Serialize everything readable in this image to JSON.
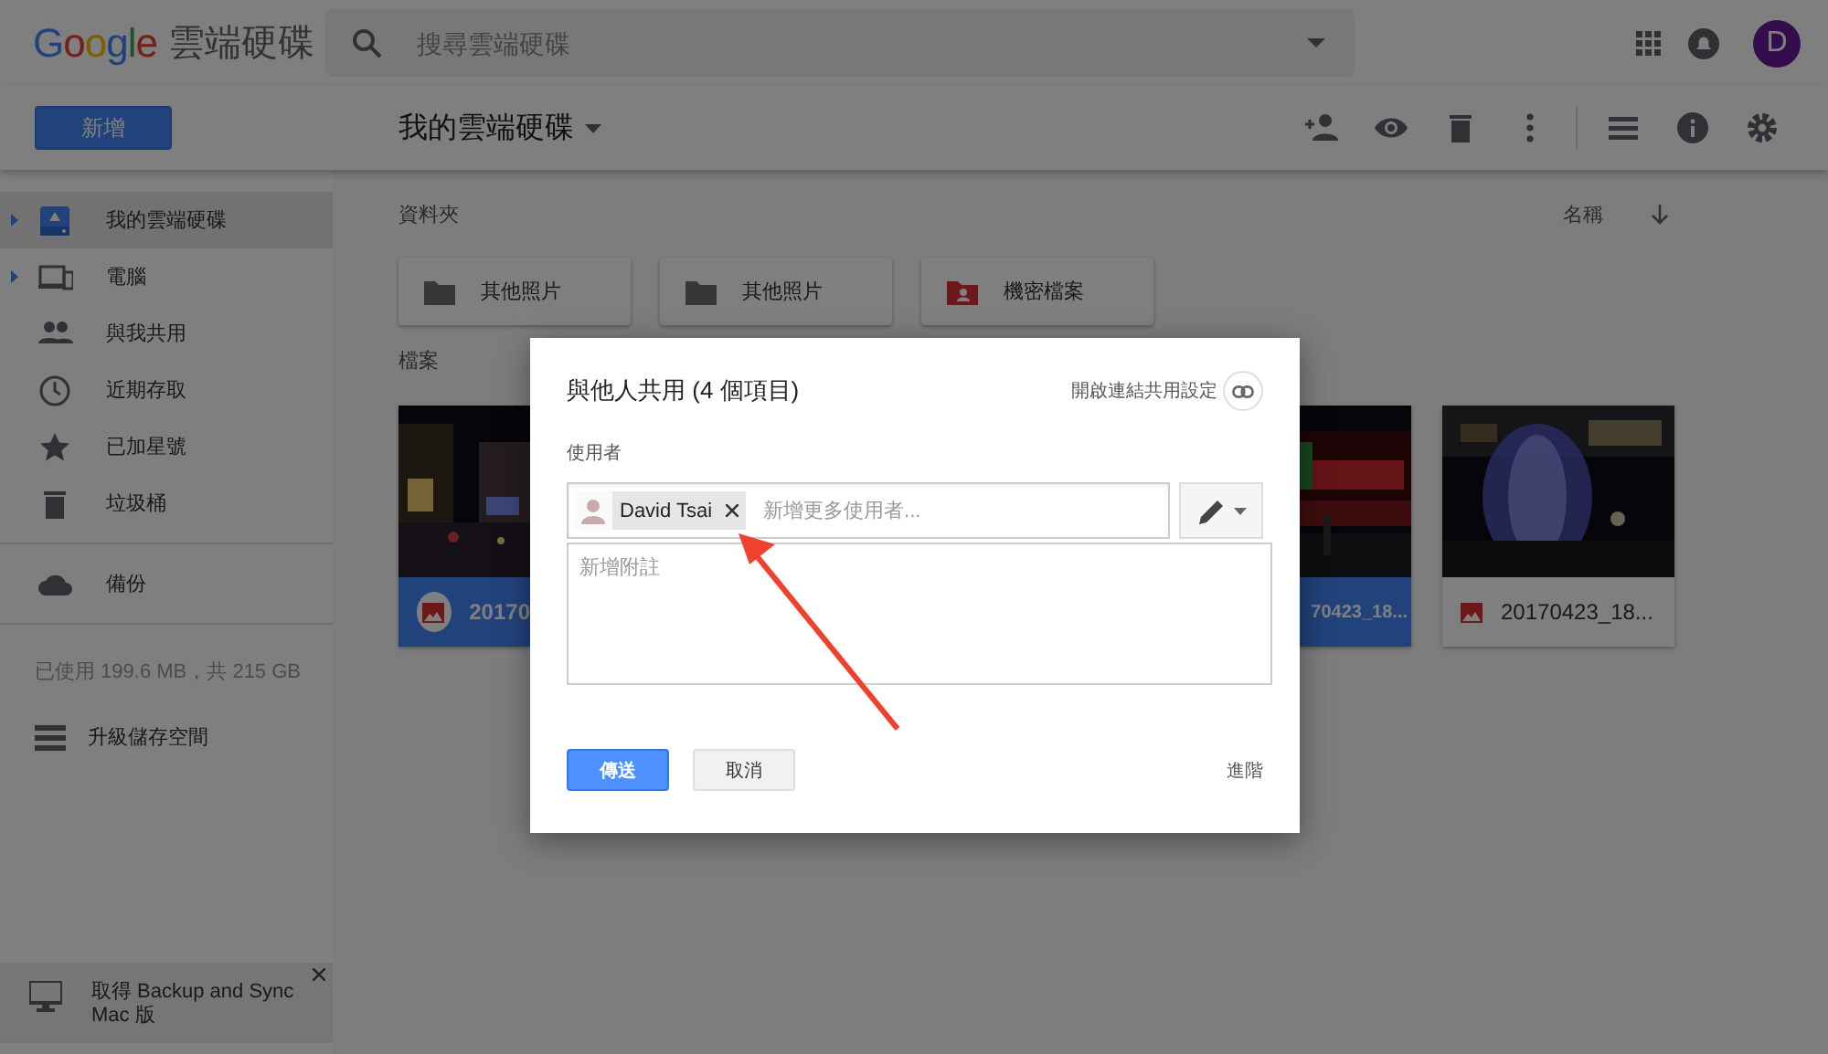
{
  "header": {
    "logo": "Google",
    "product": "雲端硬碟",
    "search": {
      "placeholder": "搜尋雲端硬碟"
    },
    "avatar": "D"
  },
  "toolbar": {
    "new_button": "新增",
    "title": "我的雲端硬碟",
    "actions": [
      {
        "kind": "share"
      },
      {
        "kind": "preview"
      },
      {
        "kind": "delete"
      },
      {
        "kind": "more"
      },
      {
        "kind": "list"
      },
      {
        "kind": "info"
      },
      {
        "kind": "settings"
      }
    ]
  },
  "sidebar": {
    "sections": [
      {
        "items": [
          {
            "label": "我的雲端硬碟",
            "kind": "drive",
            "expandable": true,
            "selected": true
          },
          {
            "label": "電腦",
            "kind": "computers",
            "expandable": true,
            "selected": false
          },
          {
            "label": "與我共用",
            "kind": "shared",
            "expandable": false,
            "selected": false
          },
          {
            "label": "近期存取",
            "kind": "recent",
            "expandable": false,
            "selected": false
          },
          {
            "label": "已加星號",
            "kind": "starred",
            "expandable": false,
            "selected": false
          },
          {
            "label": "垃圾桶",
            "kind": "trash",
            "expandable": false,
            "selected": false
          }
        ]
      },
      {
        "items": [
          {
            "label": "備份",
            "kind": "backup",
            "expandable": false,
            "selected": false
          }
        ]
      }
    ],
    "storage": "已使用 199.6 MB，共 215 GB",
    "upgrade": "升級儲存空間",
    "banner": "取得 Backup and Sync Mac 版"
  },
  "content": {
    "folders_heading": "資料夾",
    "sort": "名稱",
    "folders": [
      {
        "name": "其他照片",
        "kind": "folder",
        "selected": false
      },
      {
        "name": "其他照片",
        "kind": "folder",
        "selected": false
      },
      {
        "name": "機密檔案",
        "kind": "shared",
        "selected": false
      }
    ],
    "files_heading": "檔案",
    "files": [
      {
        "name": "20170",
        "kind": "picture",
        "selected": true
      },
      {
        "name": "70423_18...",
        "kind": "picture",
        "selected": true
      },
      {
        "name": "20170423_18...",
        "kind": "picture",
        "selected": false
      }
    ]
  },
  "dialog": {
    "title": "與他人共用 (4 個項目)",
    "link_settings": "開啟連結共用設定",
    "people_label": "使用者",
    "chips": [
      {
        "name": "David Tsai"
      }
    ],
    "people": {
      "placeholder": "新增更多使用者..."
    },
    "note": {
      "placeholder": "新增附註"
    },
    "send": "傳送",
    "cancel": "取消",
    "advanced": "進階"
  }
}
